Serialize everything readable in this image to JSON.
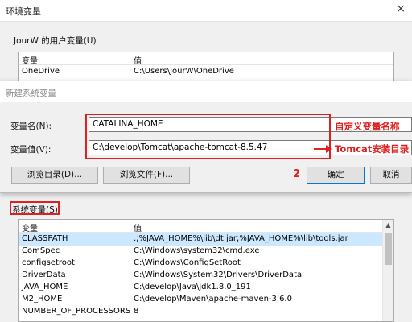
{
  "outer_window": {
    "title": "环境变量",
    "close_glyph": "×",
    "user_group_label": "JourW 的用户变量(U)",
    "user_list": {
      "col_var": "变量",
      "col_val": "值",
      "rows": [
        {
          "name": "OneDrive",
          "value": "C:\\Users\\JourW\\OneDrive"
        }
      ]
    },
    "system_group_label": "系统变量(S)",
    "system_list": {
      "col_var": "变量",
      "col_val": "值",
      "rows": [
        {
          "name": "CLASSPATH",
          "value": ".;%JAVA_HOME%\\lib\\dt.jar;%JAVA_HOME%\\lib\\tools.jar"
        },
        {
          "name": "ComSpec",
          "value": "C:\\Windows\\system32\\cmd.exe"
        },
        {
          "name": "configsetroot",
          "value": "C:\\Windows\\ConfigSetRoot"
        },
        {
          "name": "DriverData",
          "value": "C:\\Windows\\System32\\Drivers\\DriverData"
        },
        {
          "name": "JAVA_HOME",
          "value": "C:\\develop\\Java\\jdk1.8.0_191"
        },
        {
          "name": "M2_HOME",
          "value": "C:\\develop\\Maven\\apache-maven-3.6.0"
        },
        {
          "name": "NUMBER_OF_PROCESSORS",
          "value": "8"
        }
      ],
      "scroll_up_glyph": "▲"
    }
  },
  "dialog": {
    "title": "新建系统变量",
    "name_label": "变量名(N):",
    "name_value": "CATALINA_HOME",
    "value_label": "变量值(V):",
    "value_value": "C:\\develop\\Tomcat\\apache-tomcat-8.5.47",
    "browse_dir_label": "浏览目录(D)...",
    "browse_file_label": "浏览文件(F)...",
    "ok_label": "确定",
    "cancel_label": "取消"
  },
  "annotations": {
    "name_note": "自定义变量名称",
    "value_note": "Tomcat安装目录",
    "step_number": "2",
    "color": "#e02020"
  }
}
